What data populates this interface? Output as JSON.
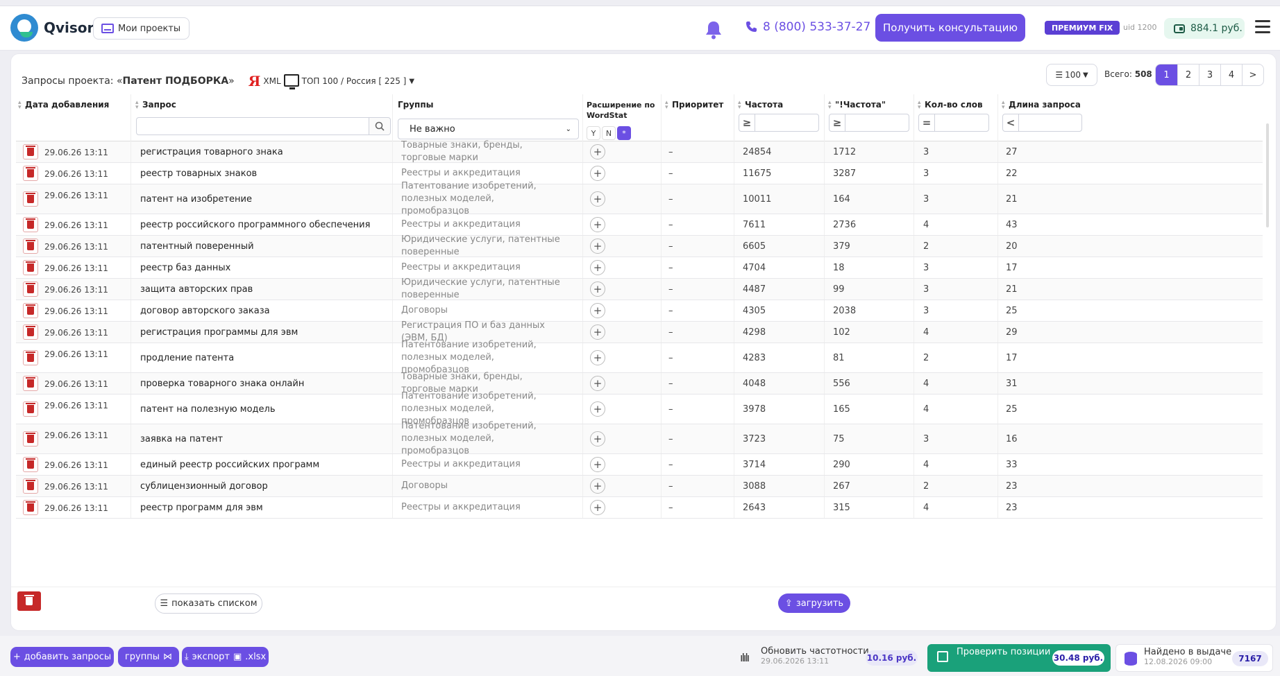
{
  "header": {
    "logo_text": "Qvisor",
    "projects_label": "Мои проекты",
    "phone": "8 (800) 533-37-27",
    "consult_label": "Получить консультацию",
    "plan_badge": "ПРЕМИУМ FIX",
    "uid": "uid 1200",
    "balance": "884.1 руб.",
    "accent": "#6b4fe3"
  },
  "project": {
    "title_prefix": "Запросы проекта: «",
    "title_name": "Патент ПОДБОРКА",
    "title_suffix": "»",
    "engine_logo": "Я",
    "engine": "XML",
    "region": "ТОП 100 / Россия [ 225 ]",
    "per_page": "100",
    "total_label": "Всего:",
    "total": "508",
    "pages": [
      "1",
      "2",
      "3",
      "4",
      ">"
    ]
  },
  "columns": {
    "date": "Дата добавления",
    "query": "Запрос",
    "groups": "Группы",
    "groups_select": "Не важно",
    "expansion_line1": "Расширение по",
    "expansion_line2": "WordStat",
    "ynw": [
      "Y",
      "N",
      "*"
    ],
    "priority": "Приоритет",
    "freq": "Частота",
    "freq_op": "≥",
    "exact_freq": "\"!Частота\"",
    "exact_op": "≥",
    "words": "Кол-во слов",
    "words_op": "=",
    "length": "Длина запроса",
    "length_op": "<"
  },
  "rows": [
    {
      "date": "29.06.26 13:11",
      "query": "регистрация товарного знака",
      "group": "Товарные знаки, бренды, торговые марки",
      "priority": "–",
      "freq": "24854",
      "exact": "1712",
      "words": "3",
      "len": "27"
    },
    {
      "date": "29.06.26 13:11",
      "query": "реестр товарных знаков",
      "group": "Реестры и аккредитация",
      "priority": "–",
      "freq": "11675",
      "exact": "3287",
      "words": "3",
      "len": "22"
    },
    {
      "date": "29.06.26 13:11",
      "query": "патент на изобретение",
      "group": "Патентование изобретений, полезных моделей, промобразцов",
      "priority": "–",
      "freq": "10011",
      "exact": "164",
      "words": "3",
      "len": "21"
    },
    {
      "date": "29.06.26 13:11",
      "query": "реестр российского программного обеспечения",
      "group": "Реестры и аккредитация",
      "priority": "–",
      "freq": "7611",
      "exact": "2736",
      "words": "4",
      "len": "43"
    },
    {
      "date": "29.06.26 13:11",
      "query": "патентный поверенный",
      "group": "Юридические услуги, патентные поверенные",
      "priority": "–",
      "freq": "6605",
      "exact": "379",
      "words": "2",
      "len": "20"
    },
    {
      "date": "29.06.26 13:11",
      "query": "реестр баз данных",
      "group": "Реестры и аккредитация",
      "priority": "–",
      "freq": "4704",
      "exact": "18",
      "words": "3",
      "len": "17"
    },
    {
      "date": "29.06.26 13:11",
      "query": "защита авторских прав",
      "group": "Юридические услуги, патентные поверенные",
      "priority": "–",
      "freq": "4487",
      "exact": "99",
      "words": "3",
      "len": "21"
    },
    {
      "date": "29.06.26 13:11",
      "query": "договор авторского заказа",
      "group": "Договоры",
      "priority": "–",
      "freq": "4305",
      "exact": "2038",
      "words": "3",
      "len": "25"
    },
    {
      "date": "29.06.26 13:11",
      "query": "регистрация программы для эвм",
      "group": "Регистрация ПО и баз данных (ЭВМ, БД)",
      "priority": "–",
      "freq": "4298",
      "exact": "102",
      "words": "4",
      "len": "29"
    },
    {
      "date": "29.06.26 13:11",
      "query": "продление патента",
      "group": "Патентование изобретений, полезных моделей, промобразцов",
      "priority": "–",
      "freq": "4283",
      "exact": "81",
      "words": "2",
      "len": "17"
    },
    {
      "date": "29.06.26 13:11",
      "query": "проверка товарного знака онлайн",
      "group": "Товарные знаки, бренды, торговые марки",
      "priority": "–",
      "freq": "4048",
      "exact": "556",
      "words": "4",
      "len": "31"
    },
    {
      "date": "29.06.26 13:11",
      "query": "патент на полезную модель",
      "group": "Патентование изобретений, полезных моделей, промобразцов",
      "priority": "–",
      "freq": "3978",
      "exact": "165",
      "words": "4",
      "len": "25"
    },
    {
      "date": "29.06.26 13:11",
      "query": "заявка на патент",
      "group": "Патентование изобретений, полезных моделей, промобразцов",
      "priority": "–",
      "freq": "3723",
      "exact": "75",
      "words": "3",
      "len": "16"
    },
    {
      "date": "29.06.26 13:11",
      "query": "единый реестр российских программ",
      "group": "Реестры и аккредитация",
      "priority": "–",
      "freq": "3714",
      "exact": "290",
      "words": "4",
      "len": "33"
    },
    {
      "date": "29.06.26 13:11",
      "query": "сублицензионный договор",
      "group": "Договоры",
      "priority": "–",
      "freq": "3088",
      "exact": "267",
      "words": "2",
      "len": "23"
    },
    {
      "date": "29.06.26 13:11",
      "query": "реестр программ для эвм",
      "group": "Реестры и аккредитация",
      "priority": "–",
      "freq": "2643",
      "exact": "315",
      "words": "4",
      "len": "23"
    }
  ],
  "table_footer": {
    "list_label": "показать списком",
    "upload_label": "загрузить"
  },
  "bottombar": {
    "add_label": "добавить запросы",
    "groups_label": "группы",
    "export_label": "экспорт",
    "export_ext": ".xlsx",
    "update_title": "Обновить частотности",
    "update_date": "29.06.2026 13:11",
    "update_price": "10.16 руб.",
    "check_title": "Проверить позиции",
    "check_price": "30.48 руб.",
    "found_title": "Найдено в выдаче",
    "found_date": "12.08.2026 09:00",
    "found_count": "7167"
  }
}
